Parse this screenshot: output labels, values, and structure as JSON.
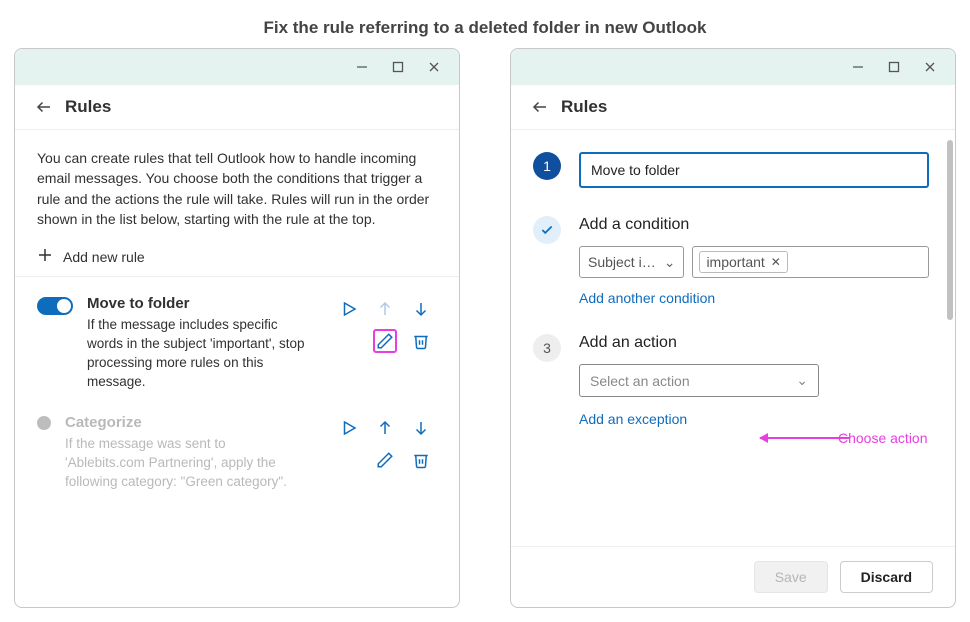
{
  "page_title": "Fix the rule referring to a deleted folder in new Outlook",
  "left": {
    "header": "Rules",
    "intro": "You can create rules that tell Outlook how to handle incoming email messages. You choose both the conditions that trigger a rule and the actions the rule will take. Rules will run in the order shown in the list below, starting with the rule at the top.",
    "add_rule": "Add new rule",
    "rules": [
      {
        "name": "Move to folder",
        "desc": "If the message includes specific words in the subject 'important', stop processing more rules on this message.",
        "enabled": true
      },
      {
        "name": "Categorize",
        "desc": "If the message was sent to 'Ablebits.com Partnering', apply the following category: \"Green category\".",
        "enabled": false
      }
    ]
  },
  "right": {
    "header": "Rules",
    "step1_value": "Move to folder",
    "step2_title": "Add a condition",
    "condition_field": "Subject i…",
    "condition_value": "important",
    "add_condition_link": "Add another condition",
    "step3_title": "Add an action",
    "action_placeholder": "Select an action",
    "add_exception_link": "Add an exception",
    "save": "Save",
    "discard": "Discard"
  },
  "annotation": "Choose action",
  "step_labels": {
    "one": "1",
    "three": "3"
  }
}
